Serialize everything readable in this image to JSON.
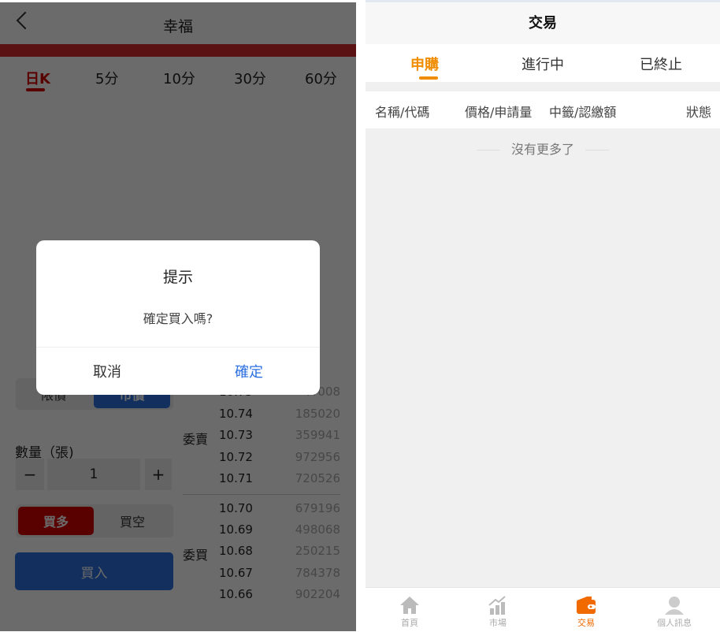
{
  "left": {
    "header": {
      "title": "幸福"
    },
    "kline_tabs": [
      "日K",
      "5分",
      "10分",
      "30分",
      "60分"
    ],
    "order_type": {
      "options": [
        "限價",
        "市價"
      ],
      "selected": "市價"
    },
    "quantity": {
      "label": "數量（張)",
      "value": "1",
      "minus": "−",
      "plus": "+"
    },
    "direction": {
      "options": [
        "買多",
        "買空"
      ],
      "selected": "買多"
    },
    "submit_label": "買入",
    "orderbook": {
      "ask_label": "委賣",
      "bid_label": "委買",
      "asks": [
        {
          "price": "10.75",
          "volume": "??008"
        },
        {
          "price": "10.74",
          "volume": "185020"
        },
        {
          "price": "10.73",
          "volume": "359941"
        },
        {
          "price": "10.72",
          "volume": "972956"
        },
        {
          "price": "10.71",
          "volume": "720526"
        }
      ],
      "bids": [
        {
          "price": "10.70",
          "volume": "679196"
        },
        {
          "price": "10.69",
          "volume": "498068"
        },
        {
          "price": "10.68",
          "volume": "250215"
        },
        {
          "price": "10.67",
          "volume": "784378"
        },
        {
          "price": "10.66",
          "volume": "902204"
        }
      ]
    },
    "dialog": {
      "title": "提示",
      "message": "確定買入嗎?",
      "cancel": "取消",
      "confirm": "確定"
    }
  },
  "right": {
    "title": "交易",
    "tabs": [
      "申購",
      "進行中",
      "已終止"
    ],
    "active_tab": "申購",
    "columns": [
      "名稱/代碼",
      "價格/申請量",
      "中籤/認繳額",
      "狀態"
    ],
    "empty_text": "沒有更多了",
    "nav": [
      {
        "label": "首頁",
        "icon": "home-icon"
      },
      {
        "label": "市場",
        "icon": "chart-icon"
      },
      {
        "label": "交易",
        "icon": "wallet-icon"
      },
      {
        "label": "個人訊息",
        "icon": "user-icon"
      }
    ],
    "active_nav": "交易"
  },
  "colors": {
    "accent_orange": "#f08c00",
    "buy_red": "#d40000",
    "primary_blue": "#2b6fe0"
  }
}
